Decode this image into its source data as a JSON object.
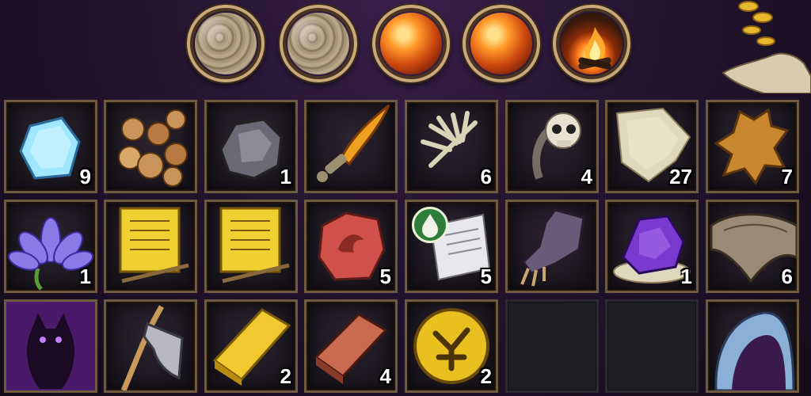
{
  "top_bar": {
    "orbs": [
      {
        "icon": "stone-orb-icon",
        "kind": "stone"
      },
      {
        "icon": "stone-orb-icon",
        "kind": "stone"
      },
      {
        "icon": "fire-orb-icon",
        "kind": "fire"
      },
      {
        "icon": "fire-orb-icon",
        "kind": "fire"
      },
      {
        "icon": "campfire-icon",
        "kind": "campfire"
      }
    ],
    "corner_icon": "coin-hand-icon"
  },
  "inventory": {
    "rows": [
      [
        {
          "item": "ice-crystal",
          "qty": "9"
        },
        {
          "item": "copper-coins",
          "qty": ""
        },
        {
          "item": "iron-ore",
          "qty": "1"
        },
        {
          "item": "fire-fang",
          "qty": ""
        },
        {
          "item": "skeleton-hand",
          "qty": "6"
        },
        {
          "item": "ghost-skull",
          "qty": "4"
        },
        {
          "item": "linen-cloth",
          "qty": "27"
        },
        {
          "item": "animal-hide",
          "qty": "7"
        }
      ],
      [
        {
          "item": "blue-lotus",
          "qty": "1"
        },
        {
          "item": "gold-scroll",
          "qty": ""
        },
        {
          "item": "gold-scroll",
          "qty": ""
        },
        {
          "item": "red-rune-stone",
          "qty": "5"
        },
        {
          "item": "water-recipe",
          "qty": "5"
        },
        {
          "item": "iron-gauntlet",
          "qty": ""
        },
        {
          "item": "amethyst-ore",
          "qty": "1"
        },
        {
          "item": "leather-scrap",
          "qty": "6"
        }
      ],
      [
        {
          "item": "shadow-demon",
          "qty": ""
        },
        {
          "item": "stone-axe",
          "qty": ""
        },
        {
          "item": "gold-ingot",
          "qty": "2"
        },
        {
          "item": "copper-ingot",
          "qty": "4"
        },
        {
          "item": "gold-rune-coin",
          "qty": "2"
        },
        {
          "item": "empty",
          "qty": ""
        },
        {
          "item": "empty",
          "qty": ""
        },
        {
          "item": "blue-hood",
          "qty": ""
        }
      ]
    ]
  },
  "colors": {
    "slot_border": "#6e5a3e",
    "orb_ring": "#c9a87a",
    "background": "#23142e",
    "qty_text": "#ffffff"
  }
}
